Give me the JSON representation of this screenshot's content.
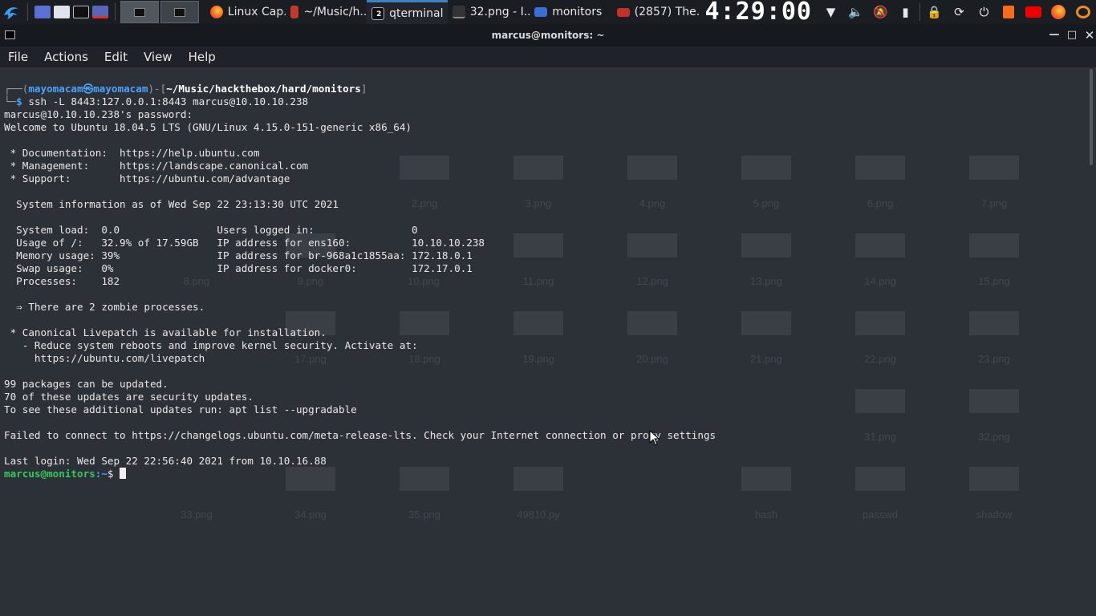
{
  "panel": {
    "tasks": [
      {
        "label": "Linux Cap...",
        "icon": "firefox-icon"
      },
      {
        "label": "~/Music/h...",
        "icon": "text-editor-icon"
      },
      {
        "label": "qterminal",
        "icon": "terminal-icon",
        "badge": "2"
      },
      {
        "label": "32.png - I...",
        "icon": "image-viewer-icon"
      },
      {
        "label": "monitors",
        "icon": "folder-icon"
      },
      {
        "label": "(2857) The...",
        "icon": "youtube-icon"
      }
    ],
    "clock": "4:29:00"
  },
  "window": {
    "title": "marcus@monitors: ~"
  },
  "menu": [
    "File",
    "Actions",
    "Edit",
    "View",
    "Help"
  ],
  "terminal": {
    "prompt_user": "mayomacam",
    "prompt_at": "㉿",
    "prompt_host": "mayomacam",
    "prompt_path": "~/Music/hackthebox/hard/monitors",
    "command": "ssh -L 8443:127.0.0.1:8443 marcus@10.10.10.238",
    "lines": [
      "marcus@10.10.10.238's password:",
      "Welcome to Ubuntu 18.04.5 LTS (GNU/Linux 4.15.0-151-generic x86_64)",
      "",
      " * Documentation:  https://help.ubuntu.com",
      " * Management:     https://landscape.canonical.com",
      " * Support:        https://ubuntu.com/advantage",
      "",
      "  System information as of Wed Sep 22 23:13:30 UTC 2021",
      "",
      "  System load:  0.0                Users logged in:                0",
      "  Usage of /:   32.9% of 17.59GB   IP address for ens160:          10.10.10.238",
      "  Memory usage: 39%                IP address for br-968a1c1855aa: 172.18.0.1",
      "  Swap usage:   0%                 IP address for docker0:         172.17.0.1",
      "  Processes:    182",
      "",
      "  ⇒ There are 2 zombie processes.",
      "",
      " * Canonical Livepatch is available for installation.",
      "   - Reduce system reboots and improve kernel security. Activate at:",
      "     https://ubuntu.com/livepatch",
      "",
      "99 packages can be updated.",
      "70 of these updates are security updates.",
      "To see these additional updates run: apt list --upgradable",
      "",
      "Failed to connect to https://changelogs.ubuntu.com/meta-release-lts. Check your Internet connection or proxy settings",
      "",
      "Last login: Wed Sep 22 22:56:40 2021 from 10.10.16.88"
    ],
    "final_prompt_user": "marcus@monitors",
    "final_prompt_path": ":~",
    "final_prompt_symbol": "$"
  },
  "ghost_files": [
    "2.png",
    "3.png",
    "4.png",
    "5.png",
    "6.png",
    "7.png",
    "8.png",
    "9.png",
    "10.png",
    "11.png",
    "12.png",
    "13.png",
    "14.png",
    "15.png",
    "17.png",
    "18.png",
    "19.png",
    "20.png",
    "21.png",
    "22.png",
    "23.png",
    "31.png",
    "32.png",
    "33.png",
    "34.png",
    "35.png",
    "49810.py",
    "hash",
    "passwd",
    "shadow"
  ],
  "colors": {
    "accent": "#3b82c4",
    "prompt_blue": "#4aa3ff",
    "prompt_green": "#35c95a"
  }
}
